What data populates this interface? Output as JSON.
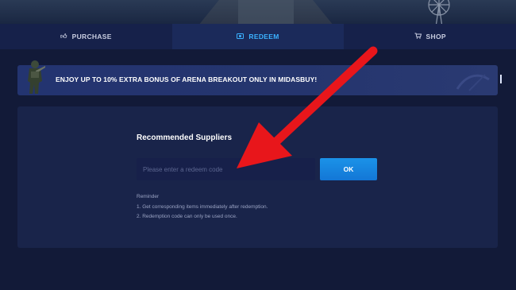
{
  "tabs": [
    {
      "label": "PURCHASE",
      "icon": "thumbs-up-icon",
      "active": false
    },
    {
      "label": "REDEEM",
      "icon": "redeem-card-icon",
      "active": true
    },
    {
      "label": "SHOP",
      "icon": "cart-icon",
      "active": false
    }
  ],
  "banner": {
    "text": "ENJOY UP TO 10% EXTRA BONUS OF ARENA BREAKOUT ONLY IN MIDASBUY!"
  },
  "redeem": {
    "title": "Recommended Suppliers",
    "input_placeholder": "Please enter a redeem code",
    "input_value": "",
    "ok_label": "OK",
    "reminder_title": "Reminder",
    "reminder_items": [
      "1. Get corresponding items immediately after redemption.",
      "2. Redemption code can only be used once."
    ]
  },
  "colors": {
    "background": "#121a38",
    "tab_active_text": "#3bb1ff",
    "button": "#1b93e8",
    "annotation_arrow": "#e8161b"
  }
}
